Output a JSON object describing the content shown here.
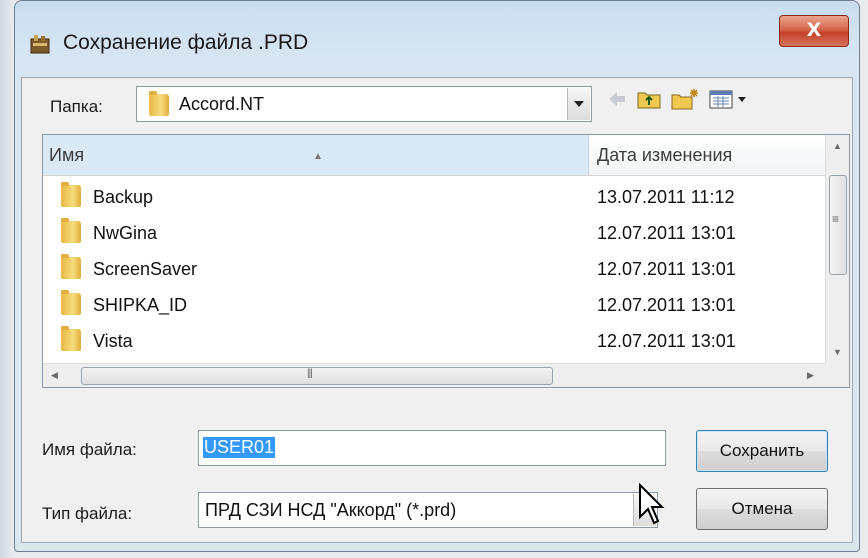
{
  "window": {
    "title": "Сохранение файла .PRD",
    "close_label": "X"
  },
  "toolbar": {
    "folder_label": "Папка:",
    "folder_value": "Accord.NT",
    "back_icon": "back-arrow-icon",
    "up_icon": "up-folder-icon",
    "new_folder_icon": "new-folder-icon",
    "view_menu_icon": "view-menu-icon"
  },
  "file_list": {
    "columns": [
      "Имя",
      "Дата изменения"
    ],
    "rows": [
      {
        "name": "Backup",
        "date": "13.07.2011 11:12"
      },
      {
        "name": "NwGina",
        "date": "12.07.2011 13:01"
      },
      {
        "name": "ScreenSaver",
        "date": "12.07.2011 13:01"
      },
      {
        "name": "SHIPKA_ID",
        "date": "12.07.2011 13:01"
      },
      {
        "name": "Vista",
        "date": "12.07.2011 13:01"
      }
    ]
  },
  "form": {
    "filename_label": "Имя файла:",
    "filename_value": "USER01",
    "filetype_label": "Тип файла:",
    "filetype_value": "ПРД СЗИ НСД \"Аккорд\" (*.prd)"
  },
  "buttons": {
    "save_label": "Сохранить",
    "cancel_label": "Отмена"
  },
  "colors": {
    "selection": "#3399ff",
    "close_button": "#c2412a",
    "header_selected": "#dae9f6"
  }
}
